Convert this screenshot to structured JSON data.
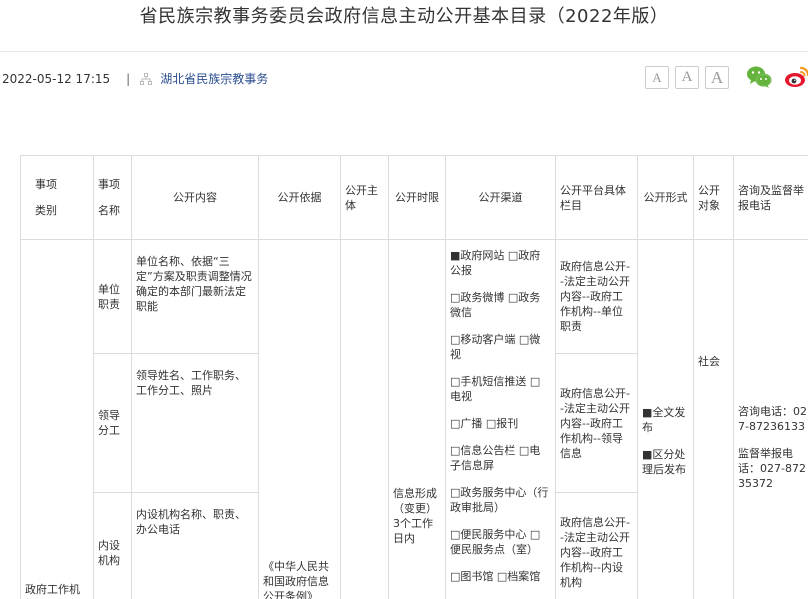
{
  "page": {
    "title": "省民族宗教事务委员会政府信息主动公开基本目录（2022年版）",
    "datetime": "2022-05-12 17:15",
    "separator": "|",
    "source": "湖北省民族宗教事务"
  },
  "toolbar": {
    "font_small": "A",
    "font_medium": "A",
    "font_large": "A",
    "share_wechat_icon": "wechat-icon",
    "share_weibo_icon": "weibo-icon"
  },
  "colors": {
    "wechat": "#63b33c",
    "weibo_red": "#e6162d",
    "weibo_orange": "#f49a1a",
    "source_link": "#2a4d8f",
    "border": "#dcdcdc"
  },
  "table": {
    "headers": {
      "category_line1": "事项",
      "category_line2": "类别",
      "name_line1": "事项",
      "name_line2": "名称",
      "content": "公开内容",
      "basis": "公开依据",
      "subject": "公开主体",
      "timeline": "公开时限",
      "channels": "公开渠道",
      "platform": "公开平台具体栏目",
      "form": "公开形式",
      "target": "公开对象",
      "consult": "咨询及监督举报电话"
    },
    "category": "政府工作机构",
    "rows": [
      {
        "name": "单位职责",
        "content": "单位名称、依据“三定”方案及职责调整情况确定的本部门最新法定职能",
        "platform": "政府信息公开--法定主动公开内容--政府工作机构--单位职责"
      },
      {
        "name": "领导分工",
        "content": "领导姓名、工作职务、工作分工、照片",
        "platform": "政府信息公开--法定主动公开内容--政府工作机构--领导信息"
      },
      {
        "name": "内设机构",
        "content": "内设机构名称、职责、办公电话",
        "platform": "政府信息公开--法定主动公开内容--政府工作机构--内设机构"
      }
    ],
    "basis": "《中华人民共和国政府信息公开条例》",
    "timeline": "信息形成（变更）3个工作日内",
    "channels": [
      "■政府网站 □政府公报",
      "□政务微博 □政务微信",
      "□移动客户端 □微视",
      "□手机短信推送 □电视",
      "□广播 □报刊",
      "□信息公告栏 □电子信息屏",
      "□政务服务中心（行政审批局）",
      "□便民服务中心 □便民服务点（室）",
      "□图书馆 □档案馆"
    ],
    "form": {
      "full": "■全文发布",
      "zoned": "■区分处理后发布"
    },
    "target": "社会",
    "consult": "咨询电话：027-87236133",
    "report": "监督举报电话：027-87235372"
  }
}
